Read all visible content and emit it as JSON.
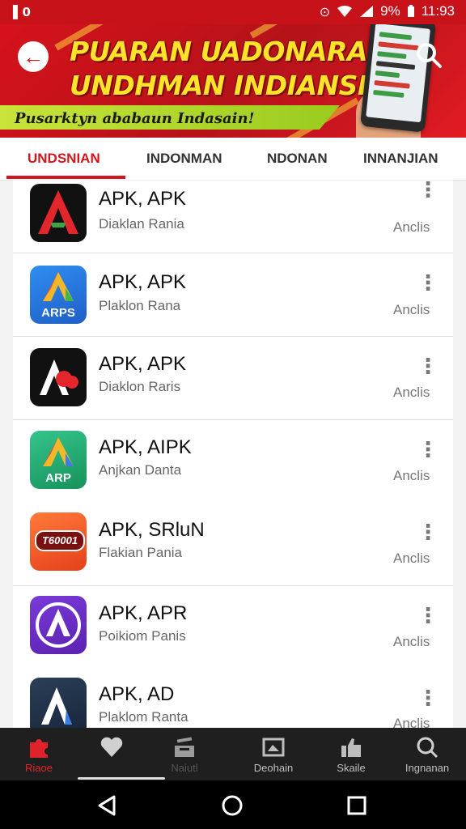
{
  "status_bar": {
    "left_text": "▌0",
    "battery_text": "9%",
    "time": "11:93"
  },
  "banner": {
    "title_line1": "PUARAN UADONARAN",
    "title_line2": "UNDHMAN INDIANSIA",
    "subtitle": "Pusarktyn ababaun Indasain!",
    "colors": {
      "background": "#c8121a",
      "title": "#ffe22a",
      "subtitle_bar": "#b9d92f"
    }
  },
  "tabs": [
    {
      "label": "UNDSNIAN",
      "active": true
    },
    {
      "label": "INDONMAN",
      "active": false
    },
    {
      "label": "NDONAN",
      "active": false
    },
    {
      "label": "INNANJIAN",
      "active": false
    }
  ],
  "apps": [
    {
      "title": "APK, APK",
      "subtitle": "Diaklan Rania",
      "action": "Anclis",
      "icon": "red-a-icon",
      "icon_text": ""
    },
    {
      "title": "APK, APK",
      "subtitle": "Plaklon Rana",
      "action": "Anclis",
      "icon": "blue-arps-icon",
      "icon_text": "ARPS"
    },
    {
      "title": "APK, APK",
      "subtitle": "Diaklon Raris",
      "action": "Anclis",
      "icon": "black-a-icon",
      "icon_text": ""
    },
    {
      "title": "APK, AIPK",
      "subtitle": "Anjkan Danta",
      "action": "Anclis",
      "icon": "green-arp-icon",
      "icon_text": "ARP"
    },
    {
      "title": "APK, SRluN",
      "subtitle": "Flakian Pania",
      "action": "Anclis",
      "icon": "orange-badge-icon",
      "icon_text": "T60001"
    },
    {
      "title": "APK, APR",
      "subtitle": "Poikiom Panis",
      "action": "Anclis",
      "icon": "purple-a-icon",
      "icon_text": ""
    },
    {
      "title": "APK, AD",
      "subtitle": "Plaklom Ranta",
      "action": "Anclis",
      "icon": "dark-a-icon",
      "icon_text": ""
    }
  ],
  "bottom_nav": [
    {
      "label": "Riaoe",
      "icon": "puzzle-icon",
      "active": true
    },
    {
      "label": "",
      "icon": "heart-icon",
      "active": false
    },
    {
      "label": "Naiutl",
      "icon": "inbox-icon",
      "active": false
    },
    {
      "label": "Deohain",
      "icon": "image-icon",
      "active": false
    },
    {
      "label": "Skaile",
      "icon": "thumbs-up-icon",
      "active": false
    },
    {
      "label": "Ingnanan",
      "icon": "search-icon",
      "active": false
    }
  ],
  "system_nav": [
    "back-icon",
    "home-icon",
    "recents-icon"
  ]
}
